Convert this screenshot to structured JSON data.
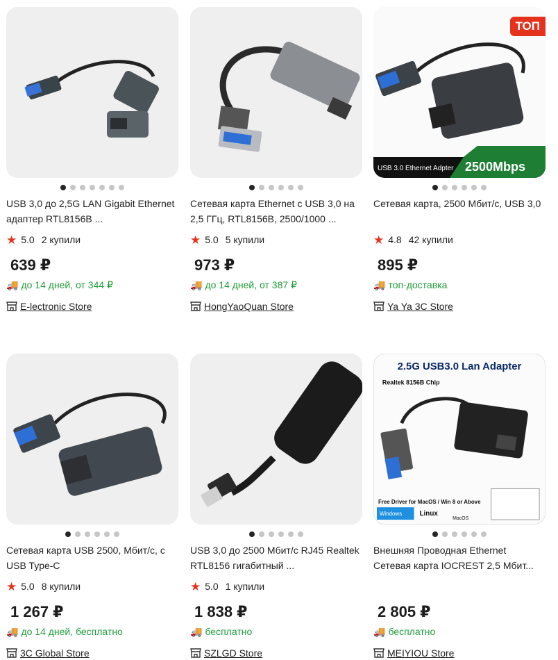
{
  "products": [
    {
      "title": "USB 3,0 до 2,5G LAN Gigabit Ethernet адаптер RTL8156B ...",
      "rating": "5.0",
      "bought": "2 купили",
      "price": "639 ₽",
      "delivery": "до 14 дней, от 344 ₽",
      "store": "E-lectronic Store"
    },
    {
      "title": "Сетевая карта Ethernet с USB 3,0 на 2,5 ГГц, RTL8156B, 2500/1000 ...",
      "rating": "5.0",
      "bought": "5 купили",
      "price": "973 ₽",
      "delivery": "до 14 дней, от 387 ₽",
      "store": "HongYaoQuan Store"
    },
    {
      "title": "Сетевая карта, 2500 Мбит/с, USB 3,0",
      "rating": "4.8",
      "bought": "42 купили",
      "price": "895 ₽",
      "delivery": "топ-доставка",
      "store": "Ya Ya 3C Store",
      "badge": "ТОП",
      "banner_left": "USB 3.0 Ethernet Adpter",
      "banner_right": "2500Mbps"
    },
    {
      "title": "Сетевая карта USB 2500, Мбит/с, с USB Type-C",
      "rating": "5.0",
      "bought": "8 купили",
      "price": "1 267 ₽",
      "delivery": "до 14 дней, бесплатно",
      "store": "3C Global Store"
    },
    {
      "title": "USB 3,0 до 2500 Мбит/с RJ45 Realtek RTL8156 гигабитный ...",
      "rating": "5.0",
      "bought": "1 купили",
      "price": "1 838 ₽",
      "delivery": "бесплатно",
      "store": "SZLGD Store"
    },
    {
      "title": "Внешняя Проводная Ethernet Сетевая карта IOCREST 2,5 Мбит...",
      "rating": "",
      "bought": "",
      "price": "2 805 ₽",
      "delivery": "бесплатно",
      "store": "MEIYIOU Store",
      "img_title": "2.5G USB3.0 Lan Adapter",
      "img_chip": "Realtek 8156B Chip",
      "img_driver": "Free Driver for MacOS / Win 8 or Above",
      "img_windows": "Windows",
      "img_linux": "Linux",
      "img_macos": "MacOS"
    }
  ],
  "icons": {
    "star": "star-icon",
    "truck": "truck-icon",
    "store": "store-icon"
  },
  "colors": {
    "accent_green": "#1f9d3a",
    "star_red": "#e0341e",
    "badge_red": "#e5321c"
  }
}
